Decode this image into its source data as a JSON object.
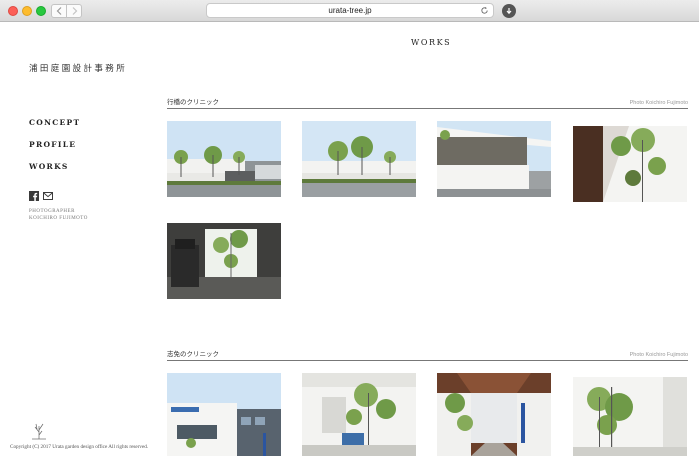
{
  "browser": {
    "url": "urata-tree.jp"
  },
  "site": {
    "brand": "浦田庭園設計事務所",
    "page_title": "WORKS",
    "nav": [
      {
        "label": "CONCEPT"
      },
      {
        "label": "PROFILE"
      },
      {
        "label": "WORKS"
      }
    ],
    "social_icons": [
      "facebook-icon",
      "mail-icon"
    ],
    "photographer_label": "PHOTOGRAPHER",
    "photographer_name": "KOICHIRO FUJIMOTO",
    "copyright": "Copyright (C) 2017 Urata garden design office All rights reserved."
  },
  "sections": [
    {
      "name": "行橋のクリニック",
      "credit": "Photo Koichiro Fujimoto",
      "photos": [
        "clinic-facade-wide",
        "clinic-facade-trees",
        "clinic-building-angle",
        "window-garden-shadow",
        "clinic-interior-window"
      ]
    },
    {
      "name": "志免のクリニック",
      "credit": "Photo Koichiro Fujimoto",
      "photos": [
        "clinic-exterior-sign",
        "courtyard-trees",
        "covered-walkway",
        "white-wall-tree"
      ]
    }
  ],
  "colors": {
    "rule": "#777777",
    "text": "#333333",
    "sky": "#cfe3f4",
    "foliage": "#6f9a48"
  }
}
